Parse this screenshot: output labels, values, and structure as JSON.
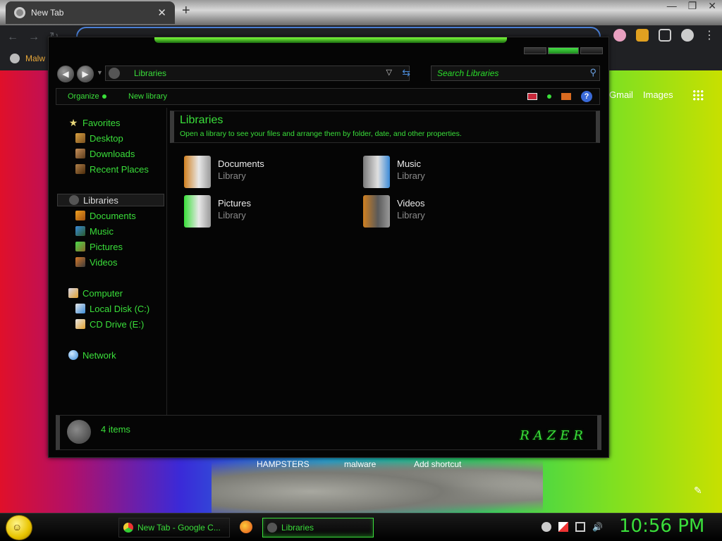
{
  "chrome": {
    "tab_title": "New Tab",
    "tab_close": "✕",
    "new_tab": "+",
    "bookmark_label": "Malw",
    "gmail": "Gmail",
    "images": "Images",
    "shortcuts": [
      {
        "label": "HAMPSTERS"
      },
      {
        "label": "malware"
      },
      {
        "label": "Add shortcut"
      }
    ]
  },
  "explorer": {
    "address_text": "Libraries",
    "search_placeholder": "Search Libraries",
    "toolbar": {
      "organize": "Organize",
      "new_library": "New library",
      "help": "?"
    },
    "nav": {
      "favorites": "Favorites",
      "desktop": "Desktop",
      "downloads": "Downloads",
      "recent_places": "Recent Places",
      "libraries": "Libraries",
      "documents": "Documents",
      "music": "Music",
      "pictures": "Pictures",
      "videos": "Videos",
      "computer": "Computer",
      "local_disk": "Local Disk (C:)",
      "cd_drive": "CD Drive (E:)",
      "network": "Network"
    },
    "header": {
      "title": "Libraries",
      "subtitle": "Open a library to see your files and arrange them by folder, date, and other properties."
    },
    "libraries": [
      {
        "name": "Documents",
        "type": "Library"
      },
      {
        "name": "Music",
        "type": "Library"
      },
      {
        "name": "Pictures",
        "type": "Library"
      },
      {
        "name": "Videos",
        "type": "Library"
      }
    ],
    "status": {
      "items": "4 items",
      "logo": "RAZER"
    }
  },
  "taskbar": {
    "chrome_task": "New Tab - Google C...",
    "libraries_task": "Libraries",
    "clock": "10:56 PM"
  },
  "colors": {
    "accent_green": "#3adf3a",
    "window_bg": "#050505"
  }
}
